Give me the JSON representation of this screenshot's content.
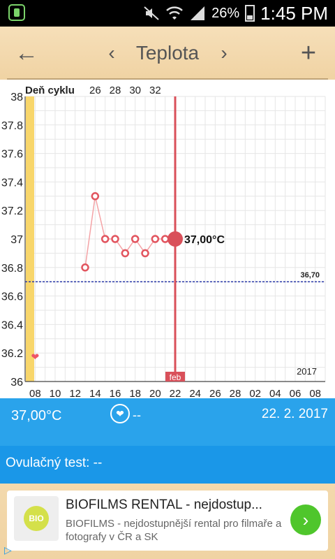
{
  "status_bar": {
    "battery": "26%",
    "time": "1:45 PM"
  },
  "toolbar": {
    "back": "←",
    "prev": "‹",
    "title": "Teplota",
    "next": "›",
    "add": "+"
  },
  "chart_data": {
    "type": "line",
    "cycle_label": "Deň cyklu",
    "cycle_ticks": [
      "26",
      "28",
      "30",
      "32"
    ],
    "y_ticks": [
      "38",
      "37.8",
      "37.6",
      "37.4",
      "37.2",
      "37",
      "36.8",
      "36.6",
      "36.4",
      "36.2",
      "36"
    ],
    "ylim": [
      36,
      38
    ],
    "x_tick_labels": [
      "08",
      "10",
      "12",
      "14",
      "16",
      "18",
      "20",
      "22",
      "24",
      "26",
      "28",
      "02",
      "04",
      "06",
      "08"
    ],
    "x_day_index": [
      8,
      10,
      12,
      14,
      16,
      18,
      20,
      22,
      24,
      26,
      28,
      30,
      32,
      34,
      36
    ],
    "xlim": [
      7,
      37
    ],
    "month_label": "feb",
    "month_label_x": 22,
    "year_label": "2017",
    "baseline": {
      "value": 36.7,
      "label": "36,70"
    },
    "selected": {
      "x": 22,
      "y": 37.0,
      "label": "37,00°C"
    },
    "series": [
      {
        "points": [
          {
            "x": 13,
            "y": 36.8
          },
          {
            "x": 14,
            "y": 37.3
          },
          {
            "x": 15,
            "y": 37.0
          },
          {
            "x": 16,
            "y": 37.0
          },
          {
            "x": 17,
            "y": 36.9
          },
          {
            "x": 18,
            "y": 37.0
          },
          {
            "x": 19,
            "y": 36.9
          },
          {
            "x": 20,
            "y": 37.0
          },
          {
            "x": 21,
            "y": 37.0
          }
        ]
      }
    ],
    "heart_marker": {
      "x": 8,
      "y": 36.15
    },
    "colors": {
      "line": "#f4a3a6",
      "marker": "#e2555f",
      "selected": "#d9505a",
      "baseline": "#2b3aa8",
      "fertile_bar": "#f8d66b",
      "grid": "#e6e6e6"
    }
  },
  "info_bar": {
    "temperature": "37,00°C",
    "heart_icon": "heart-icon",
    "dash": "--",
    "date": "22. 2. 2017"
  },
  "ovulation": {
    "label": "Ovulačný test: --"
  },
  "ad": {
    "headline": "BIOFILMS RENTAL - nejdostup...",
    "description": "BIOFILMS - nejdostupnější rental pro filmaře a fotografy v ČR a SK",
    "logo_text": "BIO"
  }
}
